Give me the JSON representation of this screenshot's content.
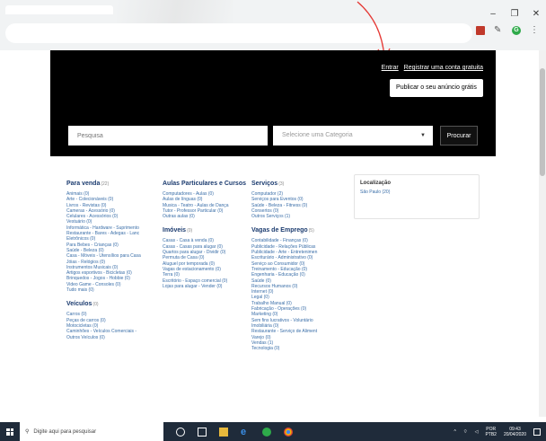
{
  "browser": {
    "window_controls": [
      "–",
      "❐",
      "✕"
    ],
    "extensions": [
      "pdf-icon",
      "pen-icon",
      "grammarly-icon",
      "menu-icon"
    ]
  },
  "header": {
    "login": "Entrar",
    "register": "Registrar uma conta gratuita",
    "publish_button": "Publicar o seu anúncio grátis"
  },
  "search": {
    "placeholder": "Pesquisa",
    "category_placeholder": "Selecione uma Categoria",
    "button": "Procurar"
  },
  "categories": {
    "para_venda": {
      "title": "Para venda",
      "count": "(22)",
      "items": [
        "Animais (0)",
        "Arte - Colecionáveis (0)",
        "Livros - Revistas (0)",
        "Cameras - Acessório (0)",
        "Celulares - Acessórios (0)",
        "Vestuário (0)",
        "Informática - Hardware - Suprimento",
        "Restaurante - Bares - Adegas - Lanc",
        "Eletrônicos (0)",
        "Para Bebes - Crianças (0)",
        "Saúde - Beleza (0)",
        "Casa - Móveis - Utensílios para Casa",
        "Jóias - Relógios (0)",
        "Instrumentos Musicais (0)",
        "Artigos esportivos - Bicicletas (0)",
        "Brinquedos - Jogos - Hobbie (0)",
        "Video Game - Consoles (0)",
        "Tudo mais (0)"
      ]
    },
    "veiculos": {
      "title": "Veículos",
      "count": "(0)",
      "items": [
        "Carros (0)",
        "Peças de carros (0)",
        "Motocicletas (0)",
        "Caminhões - Veículos Comerciais -",
        "Outros Veículos (0)"
      ]
    },
    "aulas": {
      "title": "Aulas Particulares e Cursos",
      "count": "",
      "items": [
        "Computadores - Aulas (0)",
        "Aulas de línguas (0)",
        "Musica - Teatro - Aulas de Dança",
        "Tutor - Professor Particular (0)",
        "Outras aulas (0)"
      ]
    },
    "imoveis": {
      "title": "Imóveis",
      "count": "(0)",
      "items": [
        "Casas - Casa à venda (0)",
        "Casas - Casas para alugar (0)",
        "Quartos para alugar - Dividir (0)",
        "Permuta de Casa (0)",
        "Aluguel por temporada (0)",
        "Vagas de estacionamento (0)",
        "Terra (0)",
        "Escritório - Espaço comercial (0)",
        "Lojas para alugar - Vender (0)"
      ]
    },
    "servicos": {
      "title": "Serviços",
      "count": "(3)",
      "items": [
        "Computador (2)",
        "Serviços para Eventos (0)",
        "Saúde - Beleza - Fitness (0)",
        "Consertos (0)",
        "Outros Serviços (1)"
      ]
    },
    "vagas": {
      "title": "Vagas de Emprego",
      "count": "(5)",
      "items": [
        "Contabilidade - Finanças (0)",
        "Publicidade - Relações Públicas",
        "Publicidade - Arte - Entretenimen",
        "Escriturário - Administrativo (0)",
        "Serviço ao Consumidor (0)",
        "Treinamento - Educação (0)",
        "Engenharia - Educação (0)",
        "Saúde (0)",
        "Recursos Humanos (0)",
        "Internet (0)",
        "Legal (0)",
        "Trabalho Manual (0)",
        "Fabricação - Operações (0)",
        "Marketing (0)",
        "Sem fins lucrativos - Voluntário",
        "Imobiliária (0)",
        "Restaurante - Serviço de Aliment",
        "Varejo (0)",
        "Vendas (1)",
        "Tecnologia (0)"
      ]
    }
  },
  "location": {
    "title": "Localização",
    "items": [
      "São Paulo (20)"
    ]
  },
  "taskbar": {
    "search_placeholder": "Digite aqui para pesquisar",
    "lang_top": "POR",
    "lang_bottom": "PTB2",
    "time": "09:43",
    "date": "20/04/2020"
  }
}
